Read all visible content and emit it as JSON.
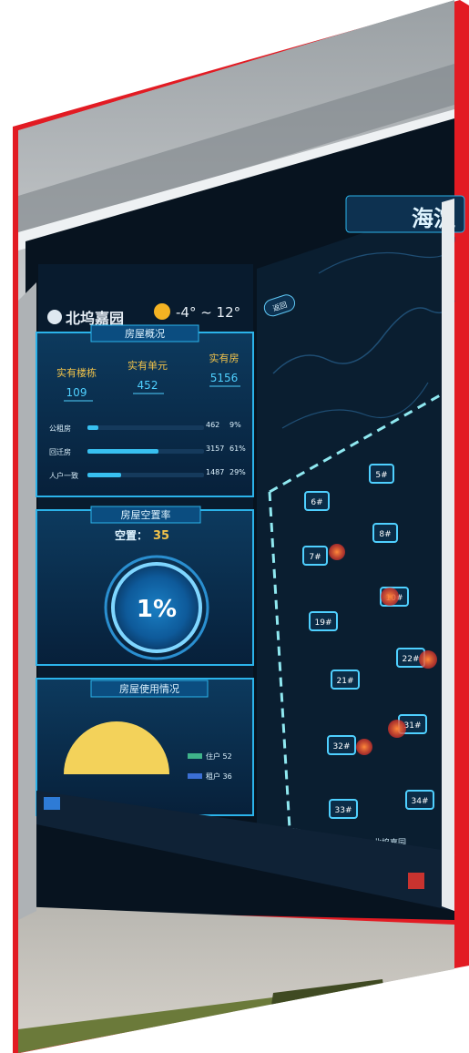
{
  "weather": {
    "location": "北坞嘉园",
    "temperature": "-4° ~ 12°"
  },
  "map": {
    "title": "海淀",
    "back_button": "返回"
  },
  "panel_housing": {
    "title": "房屋概况",
    "stats": [
      {
        "label": "实有楼栋",
        "value": "109"
      },
      {
        "label": "实有单元",
        "value": "452"
      },
      {
        "label": "实有房",
        "value": "5156"
      }
    ],
    "rows": [
      {
        "label": "公租房",
        "value": "462",
        "percent": "9%",
        "fill": 0.09
      },
      {
        "label": "回迁房",
        "value": "3157",
        "percent": "61%",
        "fill": 0.61
      },
      {
        "label": "人户一致",
        "value": "1487",
        "percent": "29%",
        "fill": 0.29
      }
    ]
  },
  "panel_vacancy": {
    "title": "房屋空置率",
    "vacant_label": "空置：",
    "vacant_value": "35",
    "rate": "1%"
  },
  "panel_usage": {
    "title": "房屋使用情况",
    "legend": [
      {
        "label": "住户 52",
        "color": "#3fb38a"
      },
      {
        "label": "租户 36",
        "color": "#3b6fd4"
      }
    ]
  },
  "buildings": [
    "5#",
    "6#",
    "7#",
    "8#",
    "10#",
    "19#",
    "21#",
    "22#",
    "31#",
    "32#",
    "33#",
    "34#"
  ],
  "map_labels": [
    "北坞嘉园"
  ],
  "colors": {
    "frame_red": "#e21b23",
    "screen_dark": "#07131f",
    "accent_cyan": "#25c3f5",
    "gold": "#f0c24a"
  }
}
